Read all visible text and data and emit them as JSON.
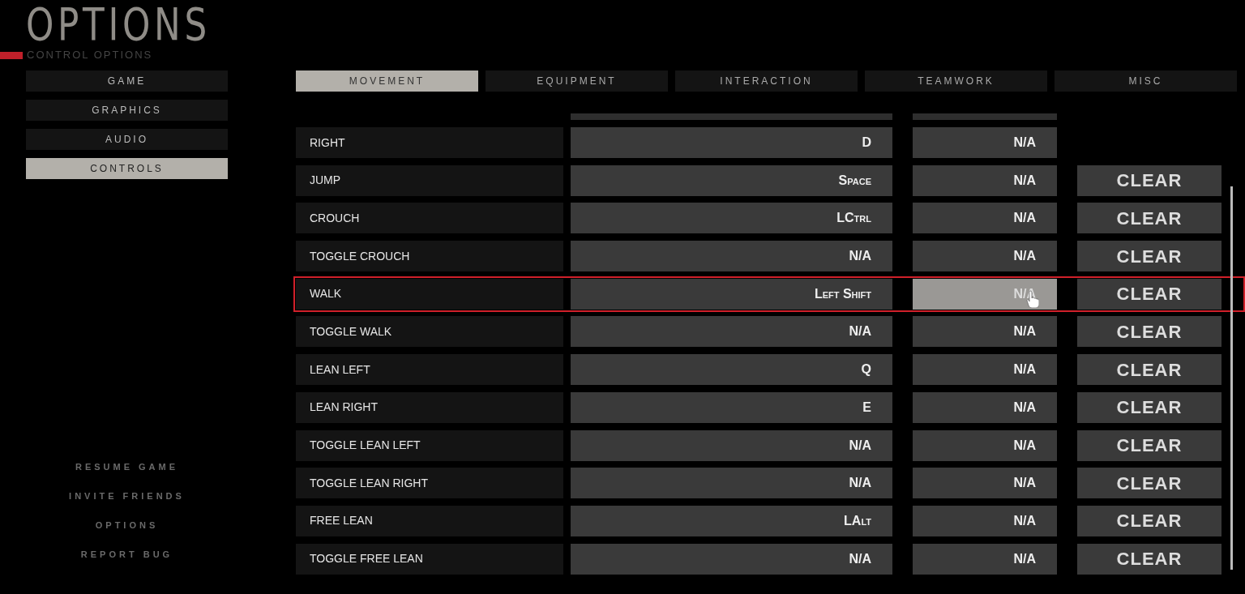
{
  "header": {
    "title": "OPTIONS",
    "subtitle": "CONTROL OPTIONS"
  },
  "sidebar": {
    "items": [
      {
        "label": "GAME",
        "selected": false
      },
      {
        "label": "GRAPHICS",
        "selected": false
      },
      {
        "label": "AUDIO",
        "selected": false
      },
      {
        "label": "CONTROLS",
        "selected": true
      }
    ]
  },
  "tabs": [
    {
      "label": "MOVEMENT",
      "selected": true
    },
    {
      "label": "EQUIPMENT",
      "selected": false
    },
    {
      "label": "INTERACTION",
      "selected": false
    },
    {
      "label": "TEAMWORK",
      "selected": false
    },
    {
      "label": "MISC",
      "selected": false
    }
  ],
  "bindings": [
    {
      "action": "RIGHT",
      "primary": "D",
      "secondary": "N/A",
      "highlighted": false,
      "hovered": false
    },
    {
      "action": "JUMP",
      "primary": "Space",
      "secondary": "N/A",
      "clear": "CLEAR",
      "highlighted": false,
      "hovered": false
    },
    {
      "action": "CROUCH",
      "primary": "LCtrl",
      "secondary": "N/A",
      "clear": "CLEAR",
      "highlighted": false,
      "hovered": false
    },
    {
      "action": "TOGGLE CROUCH",
      "primary": "N/A",
      "secondary": "N/A",
      "clear": "CLEAR",
      "highlighted": false,
      "hovered": false
    },
    {
      "action": "WALK",
      "primary": "Left Shift",
      "secondary": "N/A",
      "clear": "CLEAR",
      "highlighted": true,
      "hovered": true
    },
    {
      "action": "TOGGLE WALK",
      "primary": "N/A",
      "secondary": "N/A",
      "clear": "CLEAR",
      "highlighted": false,
      "hovered": false
    },
    {
      "action": "LEAN LEFT",
      "primary": "Q",
      "secondary": "N/A",
      "clear": "CLEAR",
      "highlighted": false,
      "hovered": false
    },
    {
      "action": "LEAN RIGHT",
      "primary": "E",
      "secondary": "N/A",
      "clear": "CLEAR",
      "highlighted": false,
      "hovered": false
    },
    {
      "action": "TOGGLE LEAN LEFT",
      "primary": "N/A",
      "secondary": "N/A",
      "clear": "CLEAR",
      "highlighted": false,
      "hovered": false
    },
    {
      "action": "TOGGLE LEAN RIGHT",
      "primary": "N/A",
      "secondary": "N/A",
      "clear": "CLEAR",
      "highlighted": false,
      "hovered": false
    },
    {
      "action": "FREE LEAN",
      "primary": "LAlt",
      "secondary": "N/A",
      "clear": "CLEAR",
      "highlighted": false,
      "hovered": false
    },
    {
      "action": "TOGGLE FREE LEAN",
      "primary": "N/A",
      "secondary": "N/A",
      "clear": "CLEAR",
      "highlighted": false,
      "hovered": false
    }
  ],
  "pause_menu": [
    "RESUME GAME",
    "INVITE FRIENDS",
    "OPTIONS",
    "REPORT BUG"
  ]
}
